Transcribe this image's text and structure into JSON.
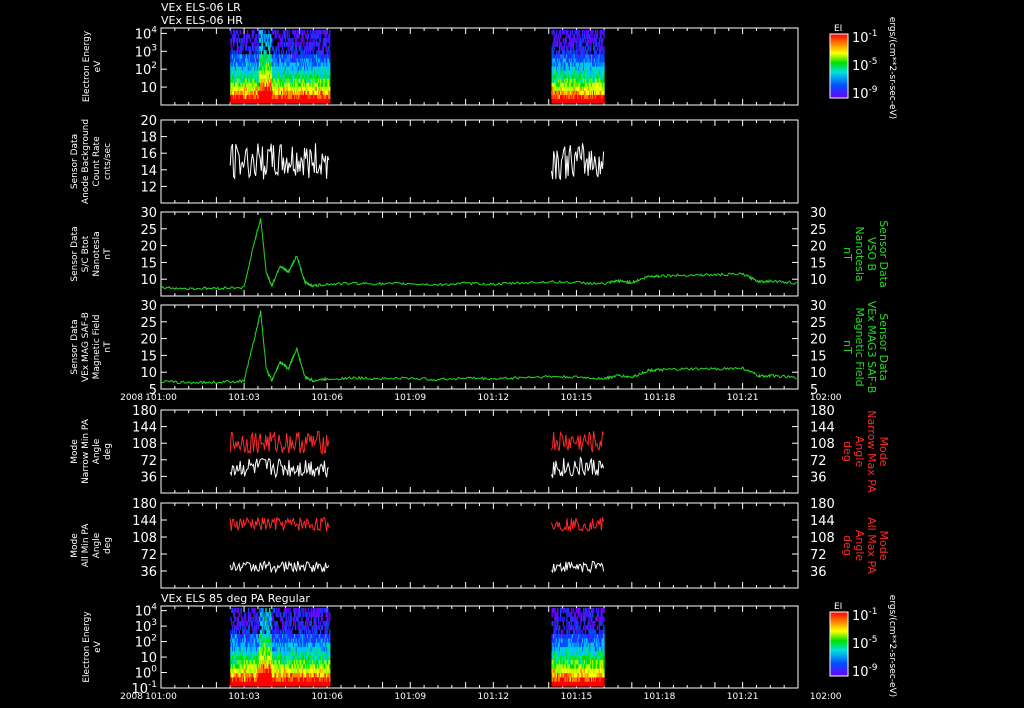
{
  "header": {
    "line1": "VEx ELS-06 LR",
    "line2": "VEx ELS-06 HR"
  },
  "colors": {
    "white": "#ffffff",
    "green": "#22dd22",
    "red": "#ff2a2a",
    "bg": "#000000"
  },
  "chart_data": [
    {
      "type": "heatmap",
      "id": "p1",
      "title": "",
      "ylabel": [
        "Electron Energy",
        "eV"
      ],
      "yscale": "log",
      "ylim": [
        1,
        20000
      ],
      "ytick_labels": [
        "10",
        "10^2",
        "10^3",
        "10^4"
      ],
      "active_x_ranges": [
        [
          102.5,
          106.1
        ],
        [
          114.1,
          116.0
        ]
      ],
      "colorbar": {
        "label": "EI",
        "ticks": [
          "10^-1",
          "10^-5",
          "10^-9"
        ],
        "units": "ergs/(cm**2-sr-sec-eV)"
      }
    },
    {
      "type": "line",
      "id": "p2",
      "ylabel": [
        "Sensor Data",
        "Anode Background",
        "Count Rate",
        "cnts/sec"
      ],
      "ylim": [
        10,
        20
      ],
      "yticks": [
        12,
        14,
        16,
        18,
        20
      ],
      "series": [
        {
          "segments": [
            [
              102.5,
              106.1
            ],
            [
              114.1,
              116.0
            ]
          ],
          "mean": 15,
          "amp": 2.2,
          "color": "white"
        }
      ]
    },
    {
      "type": "line",
      "id": "p3",
      "ylabel": [
        "Sensor Data",
        "S/C Btot",
        "Nanotesla",
        "nT"
      ],
      "right_label": [
        "Sensor Data",
        "VSO B",
        "Nanotesla",
        "nT"
      ],
      "ylim": [
        5,
        30
      ],
      "yticks": [
        10,
        15,
        20,
        25,
        30
      ],
      "series": [
        {
          "color": "green",
          "x": [
            100.0,
            101.0,
            102.0,
            103.0,
            103.4,
            103.6,
            103.8,
            104.0,
            104.3,
            104.6,
            104.9,
            105.2,
            105.5,
            106.0,
            107.0,
            108.0,
            109.0,
            110.0,
            111.0,
            112.0,
            113.0,
            114.0,
            115.0,
            116.0,
            116.5,
            117.0,
            117.6,
            118.0,
            119.0,
            120.0,
            121.0,
            121.6,
            122.0,
            123.0
          ],
          "y": [
            7.5,
            7.2,
            7.3,
            7.6,
            22,
            28,
            12,
            8,
            14,
            12,
            17,
            9,
            8,
            8.5,
            8.8,
            8.6,
            8.7,
            8.3,
            8.8,
            8.5,
            8.9,
            9.2,
            9.0,
            8.6,
            9.5,
            9.0,
            10.8,
            11.0,
            11.2,
            11.3,
            11.5,
            9.3,
            9.5,
            8.8
          ]
        }
      ]
    },
    {
      "type": "line",
      "id": "p4",
      "ylabel": [
        "Sensor Data",
        "VEx MAG SAF-B",
        "Magnetic Field",
        "nT"
      ],
      "right_label": [
        "Sensor Data",
        "VEx MAG3 SAF-B",
        "Magnetic Field",
        "nT"
      ],
      "ylim": [
        5,
        30
      ],
      "yticks": [
        5,
        10,
        15,
        20,
        25,
        30
      ],
      "year": "2008",
      "xtick_labels": [
        "101:00",
        "101:03",
        "101:06",
        "101:09",
        "101:12",
        "101:15",
        "101:18",
        "101:21",
        "102:00"
      ],
      "series": [
        {
          "color": "green",
          "x": [
            100.0,
            101.0,
            102.0,
            103.0,
            103.4,
            103.6,
            103.8,
            104.0,
            104.3,
            104.6,
            104.9,
            105.2,
            105.5,
            106.0,
            107.0,
            108.0,
            109.0,
            110.0,
            111.0,
            112.0,
            113.0,
            114.0,
            115.0,
            116.0,
            116.5,
            117.0,
            117.6,
            118.0,
            119.0,
            120.0,
            121.0,
            121.6,
            122.0,
            123.0
          ],
          "y": [
            7.2,
            6.9,
            7.0,
            7.4,
            21,
            28,
            11,
            7.5,
            13,
            11,
            17,
            8.5,
            7.5,
            8.0,
            8.3,
            8.1,
            8.2,
            7.8,
            8.3,
            8.0,
            8.4,
            8.7,
            8.5,
            8.1,
            9.0,
            8.5,
            10.5,
            10.7,
            10.9,
            11.0,
            11.2,
            8.8,
            9.0,
            8.3
          ]
        }
      ]
    },
    {
      "type": "line",
      "id": "p5",
      "ylabel": [
        "Mode",
        "Narrow Min PA",
        "Angle",
        "deg"
      ],
      "right_label": [
        "Mode",
        "Narrow Max PA",
        "Angle",
        "deg"
      ],
      "ylim": [
        0,
        180
      ],
      "yticks": [
        36,
        72,
        108,
        144,
        180
      ],
      "series": [
        {
          "name": "",
          "color": "red",
          "segments": [
            [
              102.5,
              106.1
            ],
            [
              114.1,
              116.0
            ]
          ],
          "mean": 110,
          "amp": 25
        },
        {
          "name": "",
          "color": "white",
          "segments": [
            [
              102.5,
              106.1
            ],
            [
              114.1,
              116.0
            ]
          ],
          "mean": 55,
          "amp": 22
        }
      ]
    },
    {
      "type": "line",
      "id": "p6",
      "ylabel": [
        "Mode",
        "All Min PA",
        "Angle",
        "deg"
      ],
      "right_label": [
        "Mode",
        "All Max PA",
        "Angle",
        "deg"
      ],
      "ylim": [
        0,
        180
      ],
      "yticks": [
        36,
        72,
        108,
        144,
        180
      ],
      "series": [
        {
          "color": "red",
          "segments": [
            [
              102.5,
              106.1
            ],
            [
              114.1,
              116.0
            ]
          ],
          "mean": 135,
          "amp": 15
        },
        {
          "color": "white",
          "segments": [
            [
              102.5,
              106.1
            ],
            [
              114.1,
              116.0
            ]
          ],
          "mean": 45,
          "amp": 12
        }
      ]
    },
    {
      "type": "heatmap",
      "id": "p7",
      "title": "VEx ELS 85 deg PA Regular",
      "ylabel": [
        "Electron Energy",
        "eV"
      ],
      "yscale": "log",
      "ylim": [
        0.1,
        20000
      ],
      "ytick_labels": [
        "10^-1",
        "10^0",
        "10",
        "10^2",
        "10^3",
        "10^4"
      ],
      "year": "2008",
      "xtick_labels": [
        "101:00",
        "101:03",
        "101:06",
        "101:09",
        "101:12",
        "101:15",
        "101:18",
        "101:21",
        "102:00"
      ],
      "active_x_ranges": [
        [
          102.5,
          106.1
        ],
        [
          114.1,
          116.0
        ]
      ],
      "colorbar": {
        "label": "EI",
        "ticks": [
          "10^-1",
          "10^-5",
          "10^-9"
        ],
        "units": "ergs/(cm**2-sr-sec-eV)"
      }
    }
  ]
}
